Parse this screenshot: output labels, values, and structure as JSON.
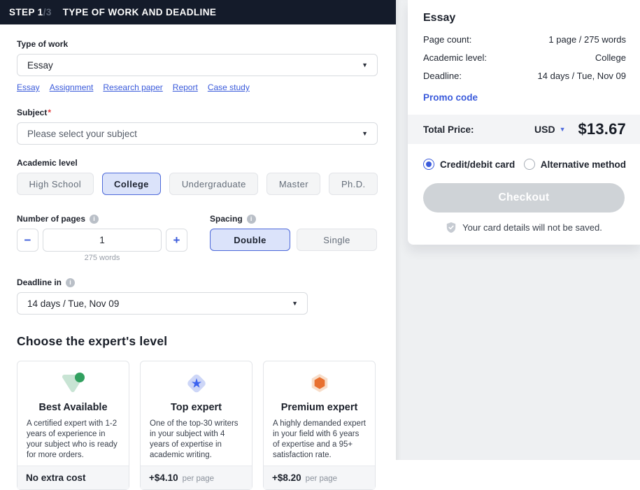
{
  "header": {
    "step_label": "STEP 1",
    "step_total": "/3",
    "title": "TYPE OF WORK AND DEADLINE"
  },
  "form": {
    "type_of_work": {
      "label": "Type of work",
      "value": "Essay",
      "quick_links": [
        "Essay",
        "Assignment",
        "Research paper",
        "Report",
        "Case study"
      ]
    },
    "subject": {
      "label": "Subject",
      "required_mark": "*",
      "placeholder": "Please select your subject"
    },
    "academic_level": {
      "label": "Academic level",
      "options": [
        "High School",
        "College",
        "Undergraduate",
        "Master",
        "Ph.D."
      ],
      "selected": "College"
    },
    "pages": {
      "label": "Number of pages",
      "minus": "−",
      "plus": "+",
      "value": "1",
      "words_hint": "275 words"
    },
    "spacing": {
      "label": "Spacing",
      "options": [
        "Double",
        "Single"
      ],
      "selected": "Double"
    },
    "deadline": {
      "label": "Deadline in",
      "value": "14 days / Tue, Nov 09"
    }
  },
  "expert": {
    "section_title": "Choose the expert's level",
    "cards": [
      {
        "icon": "best-available-icon",
        "title": "Best Available",
        "description": "A certified expert with 1-2 years of experience in your subject who is ready for more orders.",
        "price": "No extra cost",
        "price_suffix": ""
      },
      {
        "icon": "top-expert-icon",
        "title": "Top expert",
        "description": "One of the top-30 writers in your subject with 4 years of expertise in academic writing.",
        "price": "+$4.10",
        "price_suffix": "per page"
      },
      {
        "icon": "premium-expert-icon",
        "title": "Premium expert",
        "description": "A highly demanded expert in your field with 6 years of expertise and a 95+ satisfaction rate.",
        "price": "+$8.20",
        "price_suffix": "per page"
      }
    ]
  },
  "summary": {
    "title": "Essay",
    "rows": [
      {
        "label": "Page count:",
        "value": "1 page / 275 words"
      },
      {
        "label": "Academic level:",
        "value": "College"
      },
      {
        "label": "Deadline:",
        "value": "14 days / Tue, Nov 09"
      }
    ],
    "promo_link": "Promo code",
    "total": {
      "label": "Total Price:",
      "currency": "USD",
      "amount": "$13.67"
    },
    "payment_methods": [
      {
        "label": "Credit/debit card",
        "selected": true
      },
      {
        "label": "Alternative method",
        "selected": false
      }
    ],
    "checkout_label": "Checkout",
    "note": "Your card details will not be saved."
  },
  "colors": {
    "header_bg": "#141b2a",
    "accent_blue": "#3b5bdb",
    "selected_bg": "#dbe3fa",
    "panel_bg": "#eef0f2",
    "green": "#31a05f",
    "orange": "#e87030",
    "disabled_button": "#cfd3d7",
    "required_red": "#e23b3b"
  }
}
